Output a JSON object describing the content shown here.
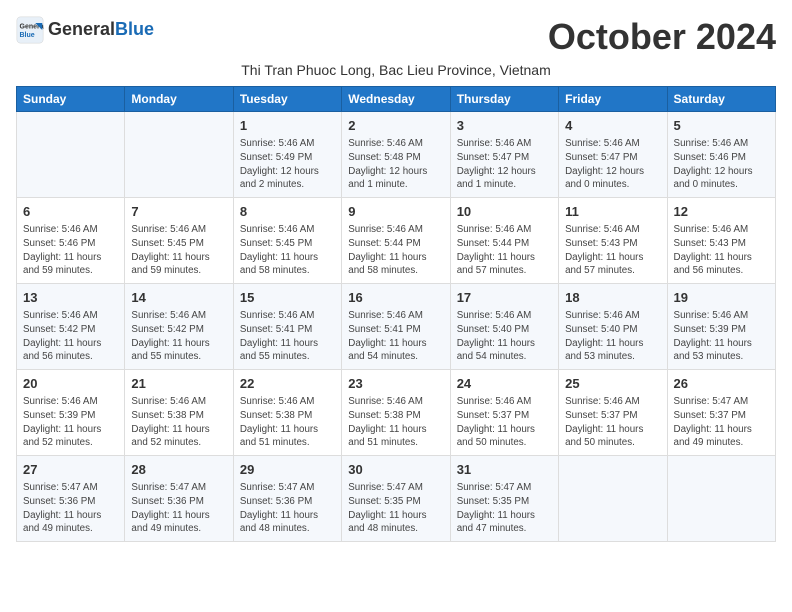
{
  "logo": {
    "general": "General",
    "blue": "Blue"
  },
  "title": "October 2024",
  "subtitle": "Thi Tran Phuoc Long, Bac Lieu Province, Vietnam",
  "days_of_week": [
    "Sunday",
    "Monday",
    "Tuesday",
    "Wednesday",
    "Thursday",
    "Friday",
    "Saturday"
  ],
  "weeks": [
    [
      {
        "day": "",
        "info": ""
      },
      {
        "day": "",
        "info": ""
      },
      {
        "day": "1",
        "info": "Sunrise: 5:46 AM\nSunset: 5:49 PM\nDaylight: 12 hours and 2 minutes."
      },
      {
        "day": "2",
        "info": "Sunrise: 5:46 AM\nSunset: 5:48 PM\nDaylight: 12 hours and 1 minute."
      },
      {
        "day": "3",
        "info": "Sunrise: 5:46 AM\nSunset: 5:47 PM\nDaylight: 12 hours and 1 minute."
      },
      {
        "day": "4",
        "info": "Sunrise: 5:46 AM\nSunset: 5:47 PM\nDaylight: 12 hours and 0 minutes."
      },
      {
        "day": "5",
        "info": "Sunrise: 5:46 AM\nSunset: 5:46 PM\nDaylight: 12 hours and 0 minutes."
      }
    ],
    [
      {
        "day": "6",
        "info": "Sunrise: 5:46 AM\nSunset: 5:46 PM\nDaylight: 11 hours and 59 minutes."
      },
      {
        "day": "7",
        "info": "Sunrise: 5:46 AM\nSunset: 5:45 PM\nDaylight: 11 hours and 59 minutes."
      },
      {
        "day": "8",
        "info": "Sunrise: 5:46 AM\nSunset: 5:45 PM\nDaylight: 11 hours and 58 minutes."
      },
      {
        "day": "9",
        "info": "Sunrise: 5:46 AM\nSunset: 5:44 PM\nDaylight: 11 hours and 58 minutes."
      },
      {
        "day": "10",
        "info": "Sunrise: 5:46 AM\nSunset: 5:44 PM\nDaylight: 11 hours and 57 minutes."
      },
      {
        "day": "11",
        "info": "Sunrise: 5:46 AM\nSunset: 5:43 PM\nDaylight: 11 hours and 57 minutes."
      },
      {
        "day": "12",
        "info": "Sunrise: 5:46 AM\nSunset: 5:43 PM\nDaylight: 11 hours and 56 minutes."
      }
    ],
    [
      {
        "day": "13",
        "info": "Sunrise: 5:46 AM\nSunset: 5:42 PM\nDaylight: 11 hours and 56 minutes."
      },
      {
        "day": "14",
        "info": "Sunrise: 5:46 AM\nSunset: 5:42 PM\nDaylight: 11 hours and 55 minutes."
      },
      {
        "day": "15",
        "info": "Sunrise: 5:46 AM\nSunset: 5:41 PM\nDaylight: 11 hours and 55 minutes."
      },
      {
        "day": "16",
        "info": "Sunrise: 5:46 AM\nSunset: 5:41 PM\nDaylight: 11 hours and 54 minutes."
      },
      {
        "day": "17",
        "info": "Sunrise: 5:46 AM\nSunset: 5:40 PM\nDaylight: 11 hours and 54 minutes."
      },
      {
        "day": "18",
        "info": "Sunrise: 5:46 AM\nSunset: 5:40 PM\nDaylight: 11 hours and 53 minutes."
      },
      {
        "day": "19",
        "info": "Sunrise: 5:46 AM\nSunset: 5:39 PM\nDaylight: 11 hours and 53 minutes."
      }
    ],
    [
      {
        "day": "20",
        "info": "Sunrise: 5:46 AM\nSunset: 5:39 PM\nDaylight: 11 hours and 52 minutes."
      },
      {
        "day": "21",
        "info": "Sunrise: 5:46 AM\nSunset: 5:38 PM\nDaylight: 11 hours and 52 minutes."
      },
      {
        "day": "22",
        "info": "Sunrise: 5:46 AM\nSunset: 5:38 PM\nDaylight: 11 hours and 51 minutes."
      },
      {
        "day": "23",
        "info": "Sunrise: 5:46 AM\nSunset: 5:38 PM\nDaylight: 11 hours and 51 minutes."
      },
      {
        "day": "24",
        "info": "Sunrise: 5:46 AM\nSunset: 5:37 PM\nDaylight: 11 hours and 50 minutes."
      },
      {
        "day": "25",
        "info": "Sunrise: 5:46 AM\nSunset: 5:37 PM\nDaylight: 11 hours and 50 minutes."
      },
      {
        "day": "26",
        "info": "Sunrise: 5:47 AM\nSunset: 5:37 PM\nDaylight: 11 hours and 49 minutes."
      }
    ],
    [
      {
        "day": "27",
        "info": "Sunrise: 5:47 AM\nSunset: 5:36 PM\nDaylight: 11 hours and 49 minutes."
      },
      {
        "day": "28",
        "info": "Sunrise: 5:47 AM\nSunset: 5:36 PM\nDaylight: 11 hours and 49 minutes."
      },
      {
        "day": "29",
        "info": "Sunrise: 5:47 AM\nSunset: 5:36 PM\nDaylight: 11 hours and 48 minutes."
      },
      {
        "day": "30",
        "info": "Sunrise: 5:47 AM\nSunset: 5:35 PM\nDaylight: 11 hours and 48 minutes."
      },
      {
        "day": "31",
        "info": "Sunrise: 5:47 AM\nSunset: 5:35 PM\nDaylight: 11 hours and 47 minutes."
      },
      {
        "day": "",
        "info": ""
      },
      {
        "day": "",
        "info": ""
      }
    ]
  ]
}
